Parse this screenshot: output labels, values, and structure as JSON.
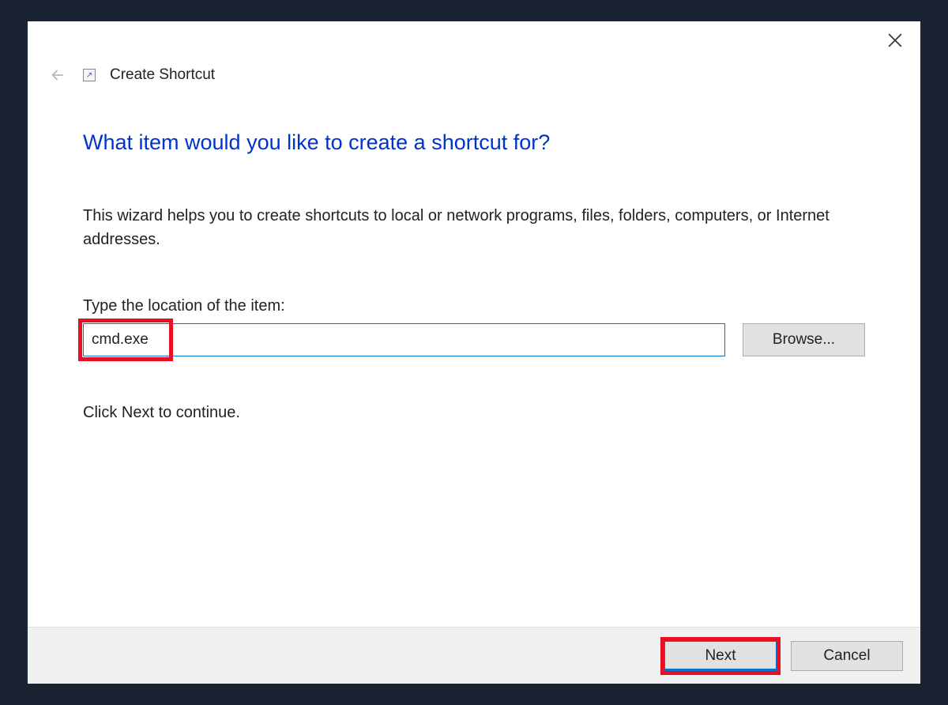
{
  "window": {
    "wizard_title": "Create Shortcut"
  },
  "main": {
    "heading": "What item would you like to create a shortcut for?",
    "description": "This wizard helps you to create shortcuts to local or network programs, files, folders, computers, or Internet addresses.",
    "field_label": "Type the location of the item:",
    "location_value": "cmd.exe",
    "browse_label": "Browse...",
    "continue_text": "Click Next to continue."
  },
  "footer": {
    "next_label": "Next",
    "cancel_label": "Cancel"
  }
}
